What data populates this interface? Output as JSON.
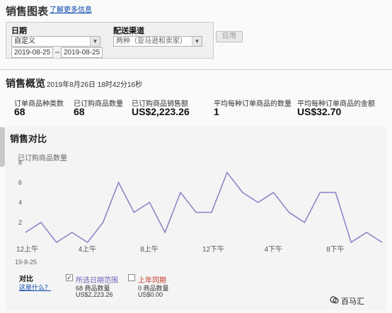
{
  "header": {
    "title": "销售图表",
    "learn_more": "了解更多信息"
  },
  "filters": {
    "date_label": "日期",
    "date_range_value": "自定义",
    "start_date": "2019-08-25",
    "end_date": "2019-08-25",
    "dash": "–",
    "channel_label": "配送渠道",
    "channel_value": "两种（亚马逊和卖家）",
    "apply_label": "应用"
  },
  "overview": {
    "title": "销售概览",
    "timestamp": "2019年8月26日 18时42分16秒",
    "metrics": [
      {
        "label": "订单商品种类数",
        "value": "68"
      },
      {
        "label": "已订购商品数量",
        "value": "68"
      },
      {
        "label": "已订购商品销售额",
        "value": "US$2,223.26"
      },
      {
        "label": "平均每种订单商品的数量",
        "value": "1"
      },
      {
        "label": "平均每种订单商品的金额",
        "value": "US$32.70"
      }
    ]
  },
  "comparison": {
    "title": "销售对比",
    "y_title": "已订购商品数量",
    "date_below": "19-8-25",
    "compare_label": "对比",
    "what_is_this": "这是什么？",
    "legend": [
      {
        "name": "所选日期范围",
        "checked": true,
        "qty": "68 商品数量",
        "amount": "US$2,223.26"
      },
      {
        "name": "上年同期",
        "checked": false,
        "qty": "0 商品数量",
        "amount": "US$0.00"
      }
    ]
  },
  "chart_data": {
    "type": "line",
    "ylabel": "已订购商品数量",
    "ylim": [
      0,
      8
    ],
    "yticks": [
      "2",
      "4",
      "6",
      "8"
    ],
    "xtick_labels": [
      "12上午",
      "4上午",
      "8上午",
      "12下午",
      "4下午",
      "8下午"
    ],
    "grid": false,
    "series": [
      {
        "color": "#8f86c7",
        "x": [
          0,
          1,
          2,
          3,
          4,
          5,
          6,
          7,
          8,
          9,
          10,
          11,
          12,
          13,
          14,
          15,
          16,
          17,
          18,
          19,
          20,
          21,
          22,
          23
        ],
        "values": [
          1,
          2,
          0,
          1,
          0,
          2,
          6,
          3,
          4,
          1,
          5,
          3,
          3,
          7,
          5,
          4,
          5,
          3,
          2,
          5,
          5,
          0,
          1,
          0
        ]
      }
    ]
  },
  "watermark": {
    "text": "百马汇"
  }
}
